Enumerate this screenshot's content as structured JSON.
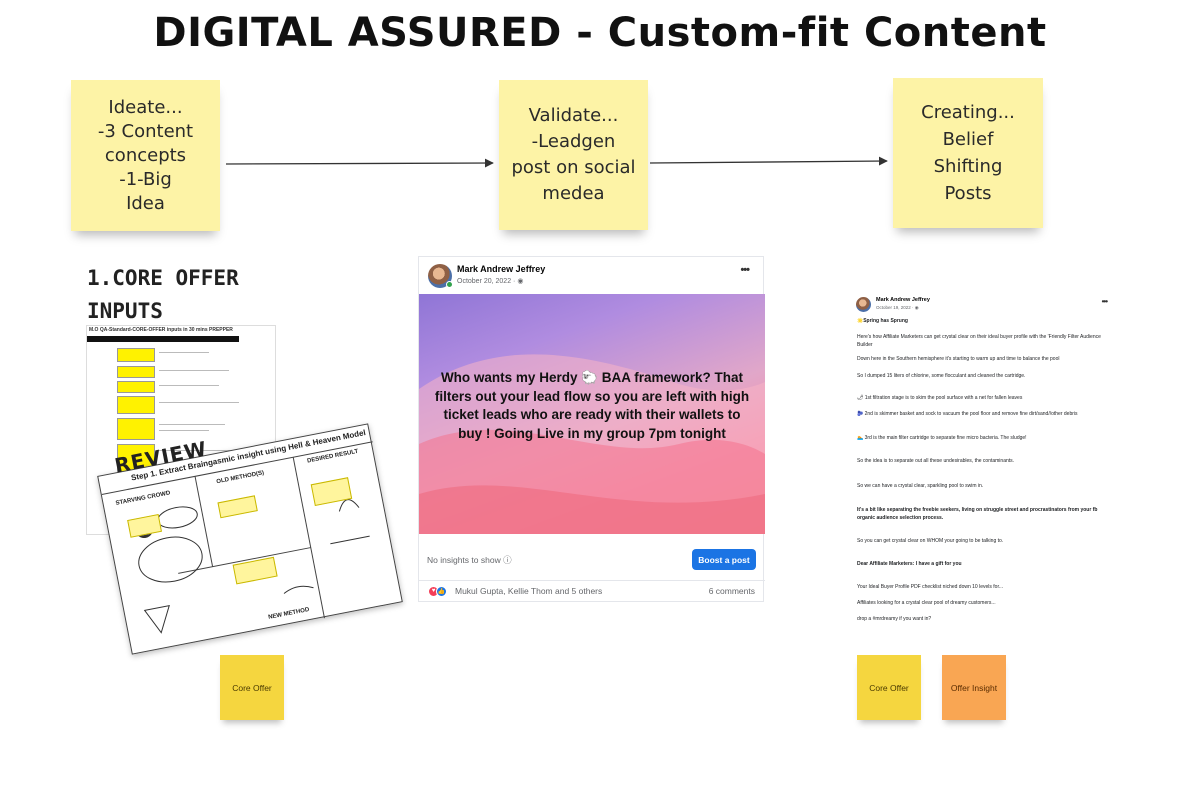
{
  "page_title": "DIGITAL ASSURED - Custom-fit Content",
  "stickies": [
    {
      "text": "Ideate...\n-3 Content\nconcepts\n-1-Big\nIdea"
    },
    {
      "text": "Validate...\n-Leadgen\npost on social\nmedea"
    },
    {
      "text": "Creating...\nBelief\nShifting\nPosts"
    }
  ],
  "core_offer": {
    "heading": "1.CORE OFFER\nINPUTS",
    "doc_title": "M.O QA-Standard-CORE-OFFER inputs in 30 mins PREPPER",
    "doc_step": "STEP 1: Prepare \"CORE\" Offer",
    "review_stamp": "REVIEW",
    "review_title": "Step 1. Extract Braingasmic insight using Hell & Heaven Model",
    "review_labels": [
      "STARVING CROWD",
      "OLD METHOD(S)",
      "DESIRED RESULT",
      "NEW METHOD"
    ]
  },
  "fb_post": {
    "author": "Mark Andrew Jeffrey",
    "date": "October 20, 2022 · ◉",
    "more": "•••",
    "media_text": "Who wants my Herdy 🐑 BAA framework? That filters out your lead flow so you are left with high ticket leads who are ready with their wallets to buy ! Going Live in my group 7pm tonight",
    "insights": "No insights to show ⓘ",
    "boost_label": "Boost a post",
    "reactions": "Mukul Gupta, Kellie Thom and 5 others",
    "comments": "6 comments"
  },
  "post2": {
    "author": "Mark Andrew Jeffrey",
    "date": "October 19, 2022 · ◉",
    "more": "•••",
    "lines": [
      {
        "text": "🌟Spring has Sprung",
        "bold": true
      },
      {
        "text": "Here's how Affiliate Marketers can get crystal clear on their ideal buyer profile  with the 'Friendly Filter Audience Builder",
        "bold": false
      },
      {
        "text": "Down here in the Southern hemisphere it's starting to warm up and time to balance the pool",
        "bold": false
      },
      {
        "text": "So I dumped 15 liters of chlorine, some flocculant and cleaned the cartridge.",
        "bold": false
      },
      {
        "text": "🌶 1st filtration stage  is to  skim the pool surface  with a net for fallen leaves",
        "bold": false
      },
      {
        "text": "🫐 2nd is skimmer basket and sock to vacuum the pool floor and remove fine dirt/sand//other debris",
        "bold": false
      },
      {
        "text": "🏊 3rd is the main filter cartridge to separate fine micro bacteria. The sludge!",
        "bold": false
      },
      {
        "text": "So the idea is to separate out all these undesirables, the contaminants.",
        "bold": false
      },
      {
        "text": "So we can have a crystal clear, sparkling pool to swim in.",
        "bold": false
      },
      {
        "text": "It's a bit like separating the freebie seekers, living on struggle street and procrastinators from your fb organic audience selection process.",
        "bold": true
      },
      {
        "text": "So you can get crystal clear on WHOM your going to be talking to.",
        "bold": false
      },
      {
        "text": "Dear Affiliate Marketers: I have a gift for you",
        "bold": true
      },
      {
        "text": "Your Ideal Buyer Profile PDF checklist niched down 10 levels for...",
        "bold": false
      },
      {
        "text": "Affiliates looking for a crystal clear pool of dreamy customers...",
        "bold": false
      },
      {
        "text": "drop a #mrdreamy if you want in?",
        "bold": false
      }
    ]
  },
  "tags": [
    {
      "text": "Core Offer",
      "color": "#f5d63f"
    },
    {
      "text": "Core Offer",
      "color": "#f5d63f"
    },
    {
      "text": "Offer Insight",
      "color": "#f9a653"
    }
  ],
  "colors": {
    "sticky": "#fdf3a6",
    "boost": "#1b74e4",
    "highlight": "#fff200"
  },
  "icons": [
    "arrow-right-icon",
    "more-options-icon",
    "love-reaction-icon",
    "like-reaction-icon",
    "info-icon",
    "globe-icon"
  ]
}
